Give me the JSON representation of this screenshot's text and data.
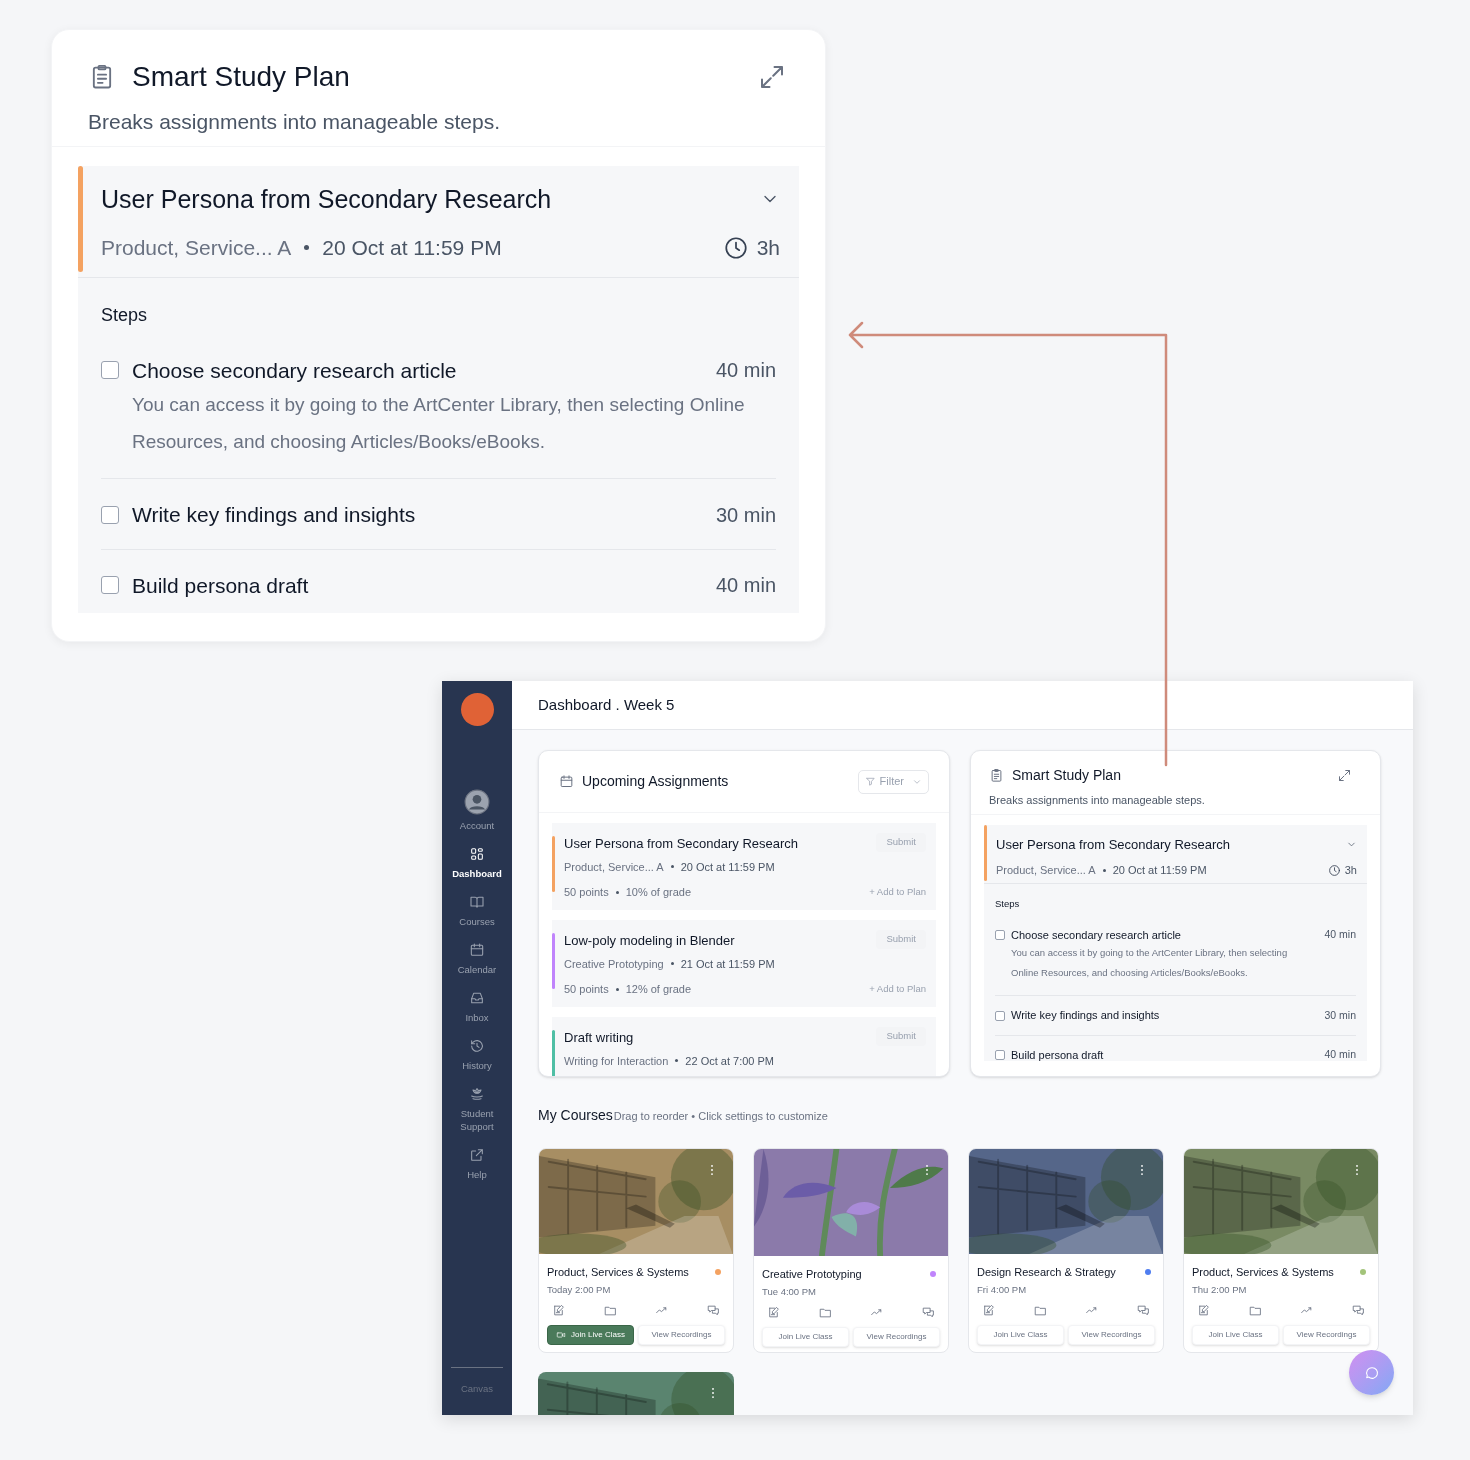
{
  "callout": {
    "title": "Smart Study Plan",
    "subtitle": "Breaks assignments into manageable steps.",
    "assignment": {
      "title": "User Persona from Secondary Research",
      "course": "Product, Service... A",
      "due": "20 Oct at 11:59 PM",
      "duration": "3h",
      "color": "#f4a261"
    },
    "steps_label": "Steps",
    "steps": [
      {
        "label": "Choose secondary research article",
        "duration": "40 min",
        "note": "You can access it by going to the ArtCenter Library, then selecting Online Resources, and choosing Articles/Books/eBooks.",
        "checked": false
      },
      {
        "label": "Write key findings and insights",
        "duration": "30 min",
        "checked": false
      },
      {
        "label": "Build persona draft",
        "duration": "40 min",
        "checked": false
      }
    ]
  },
  "dashboard": {
    "sidebar": {
      "items": [
        {
          "label": "Account",
          "selected": false
        },
        {
          "label": "Dashboard",
          "selected": true
        },
        {
          "label": "Courses",
          "selected": false
        },
        {
          "label": "Calendar",
          "selected": false
        },
        {
          "label": "Inbox",
          "selected": false
        },
        {
          "label": "History",
          "selected": false
        },
        {
          "label": "Student Support",
          "selected": false
        },
        {
          "label": "Help",
          "selected": false
        }
      ],
      "footer": "Canvas"
    },
    "header_title": "Dashboard . Week 5",
    "upcoming": {
      "title": "Upcoming Assignments",
      "filter": "Filter",
      "assignments": [
        {
          "title": "User Persona from Secondary Research",
          "course": "Product, Service... A",
          "due": "20 Oct at 11:59 PM",
          "points": "50 points",
          "grade": "10% of grade",
          "submit": "Submit",
          "add": "+ Add to Plan",
          "color": "#f4a261"
        },
        {
          "title": "Low-poly modeling in Blender",
          "course": "Creative Prototyping",
          "due": "21 Oct at 11:59 PM",
          "points": "50 points",
          "grade": "12% of grade",
          "submit": "Submit",
          "add": "+ Add to Plan",
          "color": "#c084fc"
        },
        {
          "title": "Draft writing",
          "course": "Writing for Interaction",
          "due": "22 Oct at 7:00 PM",
          "submit": "Submit",
          "color": "#4fbfa5"
        }
      ]
    },
    "study_plan": {
      "title": "Smart Study Plan",
      "subtitle": "Breaks assignments into manageable steps.",
      "assignment": {
        "title": "User Persona from Secondary Research",
        "course": "Product, Service... A",
        "due": "20 Oct at 11:59 PM",
        "duration": "3h",
        "color": "#f4a261"
      },
      "steps_label": "Steps",
      "steps": [
        {
          "label": "Choose secondary research article",
          "duration": "40 min",
          "note": "You can access it by going to the ArtCenter Library, then selecting Online Resources, and choosing Articles/Books/eBooks.",
          "checked": false
        },
        {
          "label": "Write key findings and insights",
          "duration": "30 min",
          "checked": false
        },
        {
          "label": "Build persona draft",
          "duration": "40 min",
          "checked": false
        }
      ]
    },
    "courses": {
      "title": "My Courses",
      "hint": "Drag to reorder • Click settings to customize",
      "cards": [
        {
          "name": "Product, Services & Systems",
          "time": "Today 2:00 PM",
          "color": "#f4a261",
          "join": "Join Live Class",
          "recordings": "View Recordings",
          "live": true
        },
        {
          "name": "Creative Prototyping",
          "time": "Tue 4:00 PM",
          "color": "#c084fc",
          "join": "Join Live Class",
          "recordings": "View Recordings",
          "live": false
        },
        {
          "name": "Design Research & Strategy",
          "time": "Fri 4:00 PM",
          "color": "#4f7df0",
          "join": "Join Live Class",
          "recordings": "View Recordings",
          "live": false
        },
        {
          "name": "Product, Services & Systems",
          "time": "Thu 2:00 PM",
          "color": "#a3c47a",
          "join": "Join Live Class",
          "recordings": "View Recordings",
          "live": false
        },
        {
          "kind": "picture"
        }
      ]
    }
  }
}
